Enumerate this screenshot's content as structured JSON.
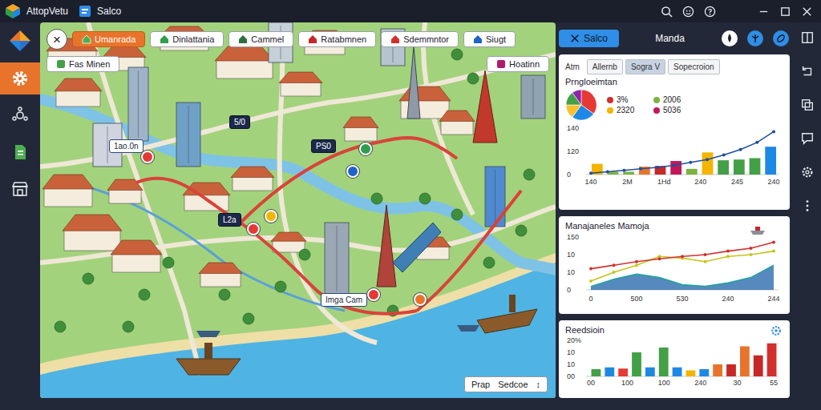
{
  "window": {
    "title": "AttopVetu",
    "tab": "Salco"
  },
  "sidebar": {
    "items": [
      {
        "selected": true
      },
      {
        "selected": false
      },
      {
        "selected": false
      },
      {
        "selected": false
      }
    ]
  },
  "map": {
    "close": "×",
    "filters": [
      {
        "label": "Umanrada",
        "selected": true,
        "color": "#4caf50"
      },
      {
        "label": "Dinlattania",
        "selected": false,
        "color": "#2e9e4f"
      },
      {
        "label": "Cammel",
        "selected": false,
        "color": "#2f6f3f"
      },
      {
        "label": "Ratabmnen",
        "selected": false,
        "color": "#c62828"
      },
      {
        "label": "Sdemmntor",
        "selected": false,
        "color": "#d32f2f"
      },
      {
        "label": "Siugt",
        "selected": false,
        "color": "#1e63c8"
      },
      {
        "label": "Fas Minen",
        "selected": false,
        "color": "#43a047"
      },
      {
        "label": "Hoatinn",
        "selected": false,
        "color": "#b0186a"
      }
    ],
    "labels": [
      {
        "text": "1ao.0n",
        "kind": "light"
      },
      {
        "text": "5/0",
        "kind": "dark"
      },
      {
        "text": "PS0",
        "kind": "dark"
      },
      {
        "text": "L2a",
        "kind": "dark"
      },
      {
        "text": "Imga Cam",
        "kind": "light"
      }
    ],
    "pins": [
      {
        "color": "#e53935"
      },
      {
        "color": "#e53935"
      },
      {
        "color": "#e53935"
      },
      {
        "color": "#f2b705"
      },
      {
        "color": "#1e63c8"
      },
      {
        "color": "#2e9e4f"
      },
      {
        "color": "#e8742c"
      }
    ],
    "dropdown": {
      "value": "Prap",
      "label": "Sedcoe",
      "arrow": "↕"
    }
  },
  "panel": {
    "button": "Salco",
    "title": "Manda",
    "overview": {
      "label": "Atm",
      "tabs": [
        {
          "label": "Allernb",
          "selected": false
        },
        {
          "label": "Sogra V",
          "selected": true
        },
        {
          "label": "Sopecroion",
          "selected": false
        }
      ],
      "title": "Prngloeimtan",
      "pie": [
        {
          "value": 35,
          "color": "#e53935"
        },
        {
          "value": 25,
          "color": "#1e88e5"
        },
        {
          "value": 15,
          "color": "#fbc02d"
        },
        {
          "value": 15,
          "color": "#43a047"
        },
        {
          "value": 10,
          "color": "#8e24aa"
        }
      ],
      "legend": [
        {
          "label": "3%",
          "color": "#d32f2f"
        },
        {
          "label": "2006",
          "color": "#7cb342"
        },
        {
          "label": "2320",
          "color": "#f4b400"
        },
        {
          "label": "5036",
          "color": "#c2185b"
        }
      ],
      "chart": {
        "y_ticks": [
          "140",
          "120",
          "0"
        ],
        "x_ticks": [
          "140",
          "2M",
          "1Hd",
          "240",
          "245",
          "240"
        ],
        "bars": [
          {
            "value": 30,
            "color": "#f4b400"
          },
          {
            "value": 8,
            "color": "#7cb342"
          },
          {
            "value": 8,
            "color": "#7cb342"
          },
          {
            "value": 22,
            "color": "#e8742c"
          },
          {
            "value": 24,
            "color": "#c62828"
          },
          {
            "value": 38,
            "color": "#c2185b"
          },
          {
            "value": 16,
            "color": "#7cb342"
          },
          {
            "value": 62,
            "color": "#f4b400"
          },
          {
            "value": 40,
            "color": "#43a047"
          },
          {
            "value": 42,
            "color": "#43a047"
          },
          {
            "value": 46,
            "color": "#43a047"
          },
          {
            "value": 78,
            "color": "#1e88e5"
          }
        ],
        "line": {
          "color": "#1f4e9c",
          "values": [
            4,
            8,
            12,
            16,
            20,
            26,
            34,
            42,
            55,
            70,
            90,
            120
          ]
        }
      }
    },
    "trend": {
      "title": "Manajaneles Mamoja",
      "y_ticks": [
        "150",
        "10",
        "10",
        "0"
      ],
      "x_ticks": [
        "0",
        "500",
        "530",
        "240",
        "244"
      ],
      "series": [
        {
          "kind": "area",
          "color": "#1e63a8",
          "values": [
            10,
            30,
            45,
            35,
            15,
            10,
            20,
            35,
            70
          ]
        },
        {
          "kind": "line",
          "color": "#c6c41e",
          "values": [
            25,
            50,
            70,
            95,
            90,
            80,
            95,
            100,
            110
          ]
        },
        {
          "kind": "line",
          "color": "#d32f2f",
          "values": [
            60,
            70,
            80,
            88,
            95,
            100,
            110,
            118,
            135
          ]
        }
      ]
    },
    "results": {
      "title": "Reedsioin",
      "y_ticks": [
        "20%",
        "10",
        "10",
        "00"
      ],
      "x_ticks": [
        "00",
        "100",
        "100",
        "240",
        "30",
        "55"
      ],
      "bars": [
        {
          "value": 12,
          "color": "#43a047"
        },
        {
          "value": 15,
          "color": "#1e88e5"
        },
        {
          "value": 13,
          "color": "#e53935"
        },
        {
          "value": 40,
          "color": "#43a047"
        },
        {
          "value": 15,
          "color": "#1e88e5"
        },
        {
          "value": 48,
          "color": "#43a047"
        },
        {
          "value": 15,
          "color": "#1e88e5"
        },
        {
          "value": 10,
          "color": "#f4b400"
        },
        {
          "value": 12,
          "color": "#1e88e5"
        },
        {
          "value": 20,
          "color": "#e8742c"
        },
        {
          "value": 20,
          "color": "#c62828"
        },
        {
          "value": 50,
          "color": "#e8742c"
        },
        {
          "value": 35,
          "color": "#c62828"
        },
        {
          "value": 55,
          "color": "#d32f2f"
        }
      ]
    }
  }
}
